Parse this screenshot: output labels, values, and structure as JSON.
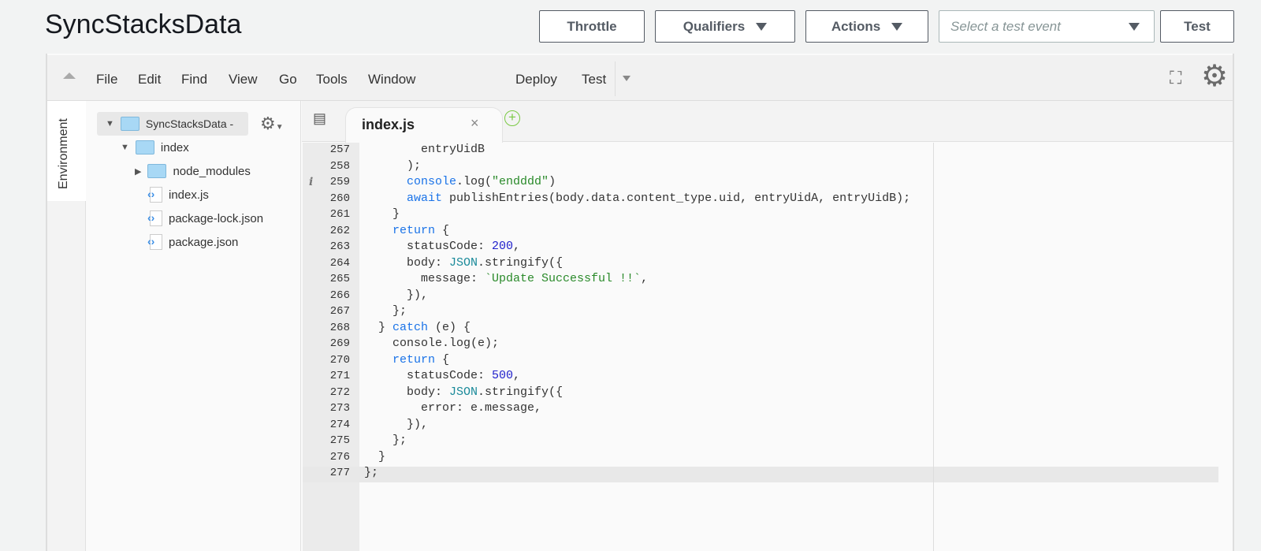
{
  "header": {
    "title": "SyncStacksData",
    "throttle": "Throttle",
    "qualifiers": "Qualifiers",
    "actions": "Actions",
    "test_event_placeholder": "Select a test event",
    "test": "Test"
  },
  "menu": {
    "items": [
      "File",
      "Edit",
      "Find",
      "View",
      "Go",
      "Tools",
      "Window"
    ],
    "deploy": "Deploy",
    "test": "Test"
  },
  "env_tab": "Environment",
  "tree": {
    "root": "SyncStacksData -",
    "items": [
      {
        "label": "index",
        "type": "folder",
        "open": true
      },
      {
        "label": "node_modules",
        "type": "folder",
        "open": false
      },
      {
        "label": "index.js",
        "type": "file"
      },
      {
        "label": "package-lock.json",
        "type": "file"
      },
      {
        "label": "package.json",
        "type": "file"
      }
    ]
  },
  "editor": {
    "tab": "index.js",
    "lines": [
      {
        "n": "257",
        "t": [
          [
            "p",
            "        entryUidB"
          ]
        ]
      },
      {
        "n": "258",
        "t": [
          [
            "p",
            "      );"
          ]
        ]
      },
      {
        "n": "259",
        "info": true,
        "t": [
          [
            "p",
            "      "
          ],
          [
            "kw",
            "console"
          ],
          [
            "p",
            ".log("
          ],
          [
            "str",
            "\"endddd\""
          ],
          [
            "p",
            ")"
          ]
        ]
      },
      {
        "n": "260",
        "t": [
          [
            "p",
            "      "
          ],
          [
            "kw",
            "await"
          ],
          [
            "p",
            " publishEntries(body.data.content_type.uid, entryUidA, entryUidB);"
          ]
        ]
      },
      {
        "n": "261",
        "t": [
          [
            "p",
            "    }"
          ]
        ]
      },
      {
        "n": "262",
        "t": [
          [
            "p",
            "    "
          ],
          [
            "kw",
            "return"
          ],
          [
            "p",
            " {"
          ]
        ]
      },
      {
        "n": "263",
        "t": [
          [
            "p",
            "      statusCode: "
          ],
          [
            "num",
            "200"
          ],
          [
            "p",
            ","
          ]
        ]
      },
      {
        "n": "264",
        "t": [
          [
            "p",
            "      body: "
          ],
          [
            "obj",
            "JSON"
          ],
          [
            "p",
            ".stringify({"
          ]
        ]
      },
      {
        "n": "265",
        "t": [
          [
            "p",
            "        message: "
          ],
          [
            "str",
            "`Update Successful !!`"
          ],
          [
            "p",
            ","
          ]
        ]
      },
      {
        "n": "266",
        "t": [
          [
            "p",
            "      }),"
          ]
        ]
      },
      {
        "n": "267",
        "t": [
          [
            "p",
            "    };"
          ]
        ]
      },
      {
        "n": "268",
        "t": [
          [
            "p",
            "  } "
          ],
          [
            "kw",
            "catch"
          ],
          [
            "p",
            " (e) {"
          ]
        ]
      },
      {
        "n": "269",
        "t": [
          [
            "p",
            "    console.log(e);"
          ]
        ]
      },
      {
        "n": "270",
        "t": [
          [
            "p",
            "    "
          ],
          [
            "kw",
            "return"
          ],
          [
            "p",
            " {"
          ]
        ]
      },
      {
        "n": "271",
        "t": [
          [
            "p",
            "      statusCode: "
          ],
          [
            "num",
            "500"
          ],
          [
            "p",
            ","
          ]
        ]
      },
      {
        "n": "272",
        "t": [
          [
            "p",
            "      body: "
          ],
          [
            "obj",
            "JSON"
          ],
          [
            "p",
            ".stringify({"
          ]
        ]
      },
      {
        "n": "273",
        "t": [
          [
            "p",
            "        error: e.message,"
          ]
        ]
      },
      {
        "n": "274",
        "t": [
          [
            "p",
            "      }),"
          ]
        ]
      },
      {
        "n": "275",
        "t": [
          [
            "p",
            "    };"
          ]
        ]
      },
      {
        "n": "276",
        "t": [
          [
            "p",
            "  }"
          ]
        ]
      },
      {
        "n": "277",
        "t": [
          [
            "p",
            "};"
          ]
        ]
      }
    ]
  },
  "icons": [
    "collapse-up-icon",
    "fullscreen-icon",
    "gear-icon",
    "tree-gear-icon",
    "tab-list-icon",
    "close-icon",
    "add-tab-icon",
    "info-icon"
  ]
}
